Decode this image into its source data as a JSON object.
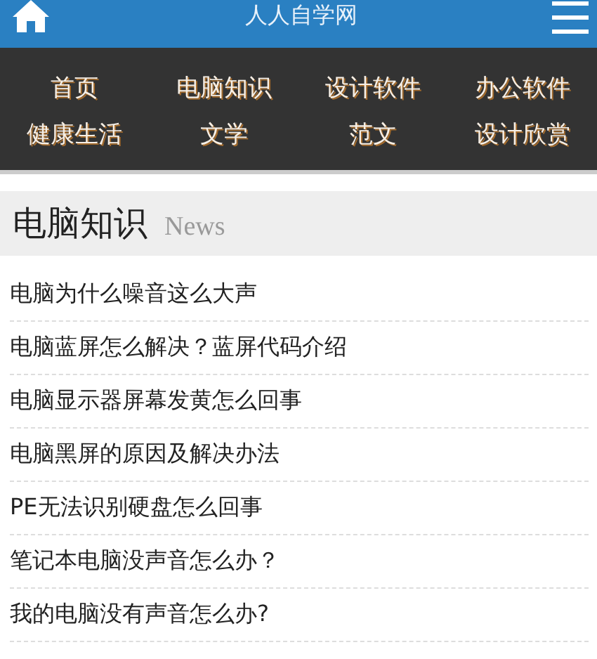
{
  "header": {
    "title": "人人自学网"
  },
  "nav": {
    "items": [
      "首页",
      "电脑知识",
      "设计软件",
      "办公软件",
      "健康生活",
      "文学",
      "范文",
      "设计欣赏"
    ]
  },
  "section": {
    "title": "电脑知识",
    "subtitle": "News"
  },
  "articles": [
    "电脑为什么噪音这么大声",
    "电脑蓝屏怎么解决？蓝屏代码介绍",
    "电脑显示器屏幕发黄怎么回事",
    "电脑黑屏的原因及解决办法",
    "PE无法识别硬盘怎么回事",
    "笔记本电脑没声音怎么办？",
    "我的电脑没有声音怎么办?"
  ]
}
